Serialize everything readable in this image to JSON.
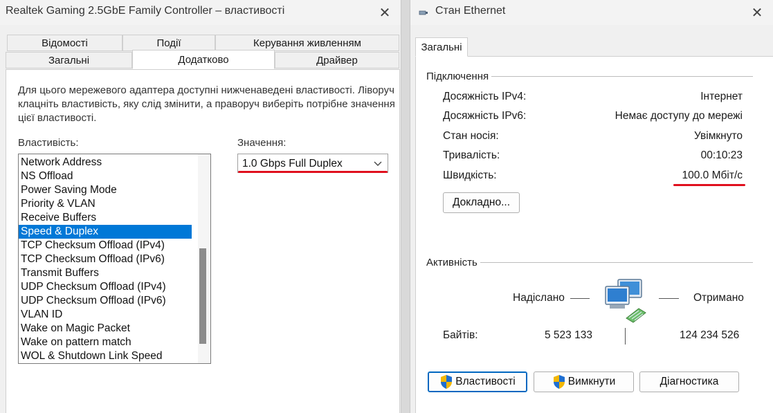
{
  "left_window": {
    "title": "Realtek Gaming 2.5GbE Family Controller – властивості",
    "tabs_row1": [
      "Відомості",
      "Події",
      "Керування живленням"
    ],
    "tabs_row2": [
      "Загальні",
      "Додатково",
      "Драйвер"
    ],
    "active_tab": "Додатково",
    "description": "Для цього мережевого адаптера доступні нижченаведені властивості. Ліворуч клацніть властивість, яку слід змінити, а праворуч виберіть потрібне значення цієї властивості.",
    "property_label": "Властивість:",
    "value_label": "Значення:",
    "properties": [
      "Network Address",
      "NS Offload",
      "Power Saving Mode",
      "Priority & VLAN",
      "Receive Buffers",
      "Speed & Duplex",
      "TCP Checksum Offload (IPv4)",
      "TCP Checksum Offload (IPv6)",
      "Transmit Buffers",
      "UDP Checksum Offload (IPv4)",
      "UDP Checksum Offload (IPv6)",
      "VLAN ID",
      "Wake on Magic Packet",
      "Wake on pattern match",
      "WOL & Shutdown Link Speed"
    ],
    "selected_property": "Speed & Duplex",
    "selected_value": "1.0 Gbps Full Duplex"
  },
  "right_window": {
    "title": "Стан Ethernet",
    "tab": "Загальні",
    "connection_group": "Підключення",
    "rows": [
      {
        "label": "Досяжність IPv4:",
        "value": "Інтернет"
      },
      {
        "label": "Досяжність IPv6:",
        "value": "Немає доступу до мережі"
      },
      {
        "label": "Стан носія:",
        "value": "Увімкнуто"
      },
      {
        "label": "Тривалість:",
        "value": "00:10:23"
      },
      {
        "label": "Швидкість:",
        "value": "100.0 Мбіт/с"
      }
    ],
    "details_button": "Докладно...",
    "activity_group": "Активність",
    "sent_label": "Надіслано",
    "received_label": "Отримано",
    "bytes_label": "Байтів:",
    "bytes_sent": "5 523 133",
    "bytes_received": "124 234 526",
    "buttons": {
      "properties": "Властивості",
      "disable": "Вимкнути",
      "diagnose": "Діагностика"
    }
  },
  "colors": {
    "selection": "#0078d7",
    "highlight_underline": "#e0101e",
    "window_bg": "#f0f0f0"
  },
  "icons": [
    "close-icon",
    "ethernet-icon",
    "chevron-down-icon",
    "network-computers-icon",
    "uac-shield-icon"
  ]
}
